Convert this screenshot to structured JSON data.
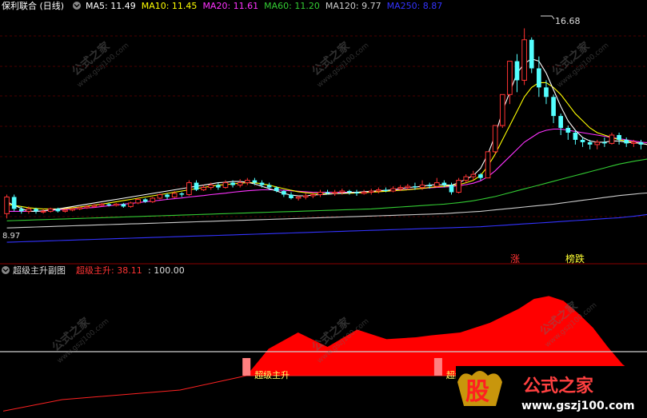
{
  "header": {
    "title": "保利联合 (日线)",
    "ma_labels": [
      {
        "text": "MA5: 11.49",
        "color": "#ffffff"
      },
      {
        "text": "MA10: 11.45",
        "color": "#ffff00"
      },
      {
        "text": "MA20: 11.61",
        "color": "#ff33ff"
      },
      {
        "text": "MA60: 11.20",
        "color": "#33cc33"
      },
      {
        "text": "MA120: 9.77",
        "color": "#cccccc"
      },
      {
        "text": "MA250: 8.87",
        "color": "#3333ff"
      }
    ]
  },
  "sub_header": {
    "title": "超级主升副图",
    "indicator_label": "超级主升: 38.11",
    "indicator_color": "#ff3333",
    "extra": ": 100.00"
  },
  "annotations": {
    "high_price": "16.68",
    "low_price": "8.97",
    "limit_up_tag": "涨",
    "list_tag": "榜跌",
    "signal_label_1": "超级主升",
    "signal_label_2": "超级主升"
  },
  "watermark": {
    "brand_glyph": "股",
    "brand_name": "公式之家",
    "brand_url": "www.gszj100.com",
    "tile_text": "公式之家",
    "tile_url": "www.gszj100.com"
  },
  "chart_data": [
    {
      "type": "candlestick",
      "title": "保利联合 (日线)",
      "colors": {
        "up": "#ff3333",
        "down": "#54ffff",
        "ma5": "#ffffff",
        "ma10": "#ffff00",
        "ma20": "#ff33ff",
        "ma60": "#33cc33",
        "ma120": "#cccccc",
        "ma250": "#3333ff"
      },
      "ylim": [
        7.2,
        17.4
      ],
      "candles": [
        [
          8.9,
          9.6,
          8.7,
          9.7
        ],
        [
          9.6,
          9.1,
          9.0,
          9.7
        ],
        [
          9.1,
          9.0,
          8.9,
          9.2
        ],
        [
          9.0,
          9.1,
          8.9,
          9.2
        ],
        [
          9.1,
          9.0,
          8.9,
          9.15
        ],
        [
          9.0,
          9.0,
          8.9,
          9.1
        ],
        [
          9.0,
          9.1,
          8.95,
          9.15
        ],
        [
          9.1,
          9.0,
          8.95,
          9.15
        ],
        [
          9.0,
          9.05,
          8.95,
          9.1
        ],
        [
          9.05,
          9.1,
          9.0,
          9.15
        ],
        [
          9.1,
          9.15,
          9.05,
          9.2
        ],
        [
          9.15,
          9.2,
          9.1,
          9.25
        ],
        [
          9.2,
          9.25,
          9.15,
          9.3
        ],
        [
          9.25,
          9.3,
          9.2,
          9.35
        ],
        [
          9.3,
          9.25,
          9.2,
          9.35
        ],
        [
          9.25,
          9.3,
          9.2,
          9.35
        ],
        [
          9.3,
          9.2,
          9.15,
          9.35
        ],
        [
          9.2,
          9.35,
          9.15,
          9.4
        ],
        [
          9.35,
          9.5,
          9.3,
          9.55
        ],
        [
          9.5,
          9.4,
          9.35,
          9.55
        ],
        [
          9.4,
          9.55,
          9.35,
          9.6
        ],
        [
          9.55,
          9.7,
          9.5,
          9.75
        ],
        [
          9.7,
          9.6,
          9.5,
          9.75
        ],
        [
          9.6,
          9.75,
          9.55,
          9.85
        ],
        [
          9.75,
          9.7,
          9.6,
          9.8
        ],
        [
          9.7,
          10.2,
          9.65,
          10.3
        ],
        [
          10.2,
          9.9,
          9.85,
          10.3
        ],
        [
          9.9,
          10.0,
          9.85,
          10.1
        ],
        [
          10.0,
          10.1,
          9.9,
          10.2
        ],
        [
          10.1,
          10.0,
          9.9,
          10.2
        ],
        [
          10.0,
          10.2,
          9.95,
          10.3
        ],
        [
          10.2,
          10.1,
          10.0,
          10.3
        ],
        [
          10.1,
          10.2,
          10.0,
          10.35
        ],
        [
          10.2,
          10.3,
          10.1,
          10.4
        ],
        [
          10.3,
          10.2,
          10.1,
          10.4
        ],
        [
          10.2,
          10.1,
          10.0,
          10.3
        ],
        [
          10.1,
          10.0,
          9.9,
          10.2
        ],
        [
          10.0,
          9.85,
          9.8,
          10.05
        ],
        [
          9.85,
          9.7,
          9.6,
          9.9
        ],
        [
          9.7,
          9.55,
          9.5,
          9.8
        ],
        [
          9.55,
          9.6,
          9.45,
          9.65
        ],
        [
          9.6,
          9.65,
          9.5,
          9.75
        ],
        [
          9.65,
          9.7,
          9.55,
          9.8
        ],
        [
          9.7,
          9.8,
          9.6,
          9.9
        ],
        [
          9.8,
          9.75,
          9.7,
          9.9
        ],
        [
          9.75,
          9.8,
          9.65,
          9.9
        ],
        [
          9.8,
          9.85,
          9.7,
          9.95
        ],
        [
          9.85,
          9.8,
          9.7,
          9.9
        ],
        [
          9.8,
          9.75,
          9.65,
          9.9
        ],
        [
          9.75,
          9.8,
          9.7,
          9.9
        ],
        [
          9.8,
          9.85,
          9.7,
          9.95
        ],
        [
          9.85,
          9.9,
          9.75,
          10.0
        ],
        [
          9.9,
          9.85,
          9.8,
          10.0
        ],
        [
          9.85,
          9.95,
          9.8,
          10.05
        ],
        [
          9.95,
          10.0,
          9.85,
          10.1
        ],
        [
          10.0,
          10.05,
          9.9,
          10.15
        ],
        [
          10.05,
          10.0,
          9.9,
          10.2
        ],
        [
          10.0,
          10.1,
          9.9,
          10.3
        ],
        [
          10.1,
          10.05,
          9.95,
          10.2
        ],
        [
          10.05,
          10.2,
          10.0,
          10.4
        ],
        [
          10.2,
          10.1,
          10.0,
          10.3
        ],
        [
          10.1,
          9.8,
          9.7,
          10.2
        ],
        [
          9.8,
          10.3,
          9.75,
          10.4
        ],
        [
          10.3,
          10.45,
          10.2,
          10.55
        ],
        [
          10.45,
          10.55,
          10.3,
          10.7
        ],
        [
          10.55,
          10.4,
          10.3,
          10.6
        ],
        [
          10.4,
          11.5,
          10.4,
          11.5
        ],
        [
          11.5,
          12.6,
          11.4,
          12.6
        ],
        [
          12.6,
          13.9,
          12.5,
          13.9
        ],
        [
          13.9,
          15.3,
          13.5,
          15.3
        ],
        [
          15.3,
          14.5,
          14.0,
          15.6
        ],
        [
          14.5,
          16.2,
          14.3,
          16.68
        ],
        [
          16.2,
          15.0,
          14.8,
          16.3
        ],
        [
          15.0,
          14.2,
          13.8,
          15.5
        ],
        [
          14.2,
          13.8,
          13.5,
          14.5
        ],
        [
          13.8,
          13.0,
          12.7,
          13.9
        ],
        [
          13.0,
          12.5,
          12.2,
          13.1
        ],
        [
          12.5,
          12.3,
          12.0,
          12.6
        ],
        [
          12.3,
          12.0,
          11.8,
          12.4
        ],
        [
          12.0,
          11.9,
          11.7,
          12.1
        ],
        [
          11.9,
          11.8,
          11.6,
          12.0
        ],
        [
          11.8,
          11.9,
          11.6,
          12.0
        ],
        [
          11.9,
          11.85,
          11.7,
          12.1
        ],
        [
          11.85,
          12.2,
          11.8,
          12.3
        ],
        [
          12.2,
          12.0,
          11.8,
          12.3
        ],
        [
          12.0,
          11.85,
          11.7,
          12.1
        ],
        [
          11.85,
          11.9,
          11.7,
          12.0
        ],
        [
          11.9,
          11.8,
          11.6,
          12.0
        ]
      ],
      "ma": {
        "ma5": [
          9.4,
          9.25,
          9.12,
          9.0,
          9.0,
          9.02,
          9.06,
          9.1,
          9.15,
          9.2,
          9.25,
          9.3,
          9.35,
          9.4,
          9.45,
          9.5,
          9.55,
          9.6,
          9.65,
          9.7,
          9.75,
          9.8,
          9.85,
          9.9,
          9.95,
          10.0,
          10.05,
          10.1,
          10.15,
          10.2,
          10.22,
          10.25,
          10.25,
          10.22,
          10.15,
          10.05,
          9.95,
          9.85,
          9.75,
          9.68,
          9.65,
          9.65,
          9.68,
          9.7,
          9.72,
          9.74,
          9.76,
          9.78,
          9.8,
          9.82,
          9.84,
          9.86,
          9.88,
          9.9,
          9.95,
          10.0,
          10.02,
          10.05,
          10.1,
          10.12,
          10.1,
          10.1,
          10.2,
          10.35,
          10.5,
          10.8,
          11.4,
          12.2,
          13.2,
          14.0,
          14.8,
          15.2,
          15.4,
          15.3,
          14.8,
          14.1,
          13.4,
          12.8,
          12.4,
          12.1,
          11.95,
          11.9,
          11.9,
          11.95,
          11.95,
          11.9,
          11.88,
          11.85,
          11.8
        ],
        "ma10": [
          9.3,
          9.25,
          9.2,
          9.15,
          9.12,
          9.1,
          9.1,
          9.1,
          9.12,
          9.15,
          9.18,
          9.22,
          9.26,
          9.3,
          9.35,
          9.4,
          9.45,
          9.5,
          9.55,
          9.6,
          9.65,
          9.7,
          9.75,
          9.8,
          9.85,
          9.9,
          9.95,
          10.0,
          10.05,
          10.1,
          10.12,
          10.15,
          10.18,
          10.2,
          10.2,
          10.15,
          10.1,
          10.02,
          9.95,
          9.88,
          9.82,
          9.78,
          9.75,
          9.74,
          9.74,
          9.74,
          9.75,
          9.76,
          9.77,
          9.78,
          9.8,
          9.82,
          9.84,
          9.86,
          9.88,
          9.9,
          9.93,
          9.96,
          10.0,
          10.03,
          10.05,
          10.08,
          10.12,
          10.2,
          10.3,
          10.5,
          10.9,
          11.4,
          12.0,
          12.6,
          13.2,
          13.8,
          14.2,
          14.4,
          14.4,
          14.2,
          13.9,
          13.5,
          13.1,
          12.8,
          12.5,
          12.3,
          12.2,
          12.1,
          12.0,
          11.95,
          11.9,
          11.85,
          11.8
        ],
        "ma20": [
          9.0,
          9.0,
          9.0,
          9.0,
          9.0,
          9.02,
          9.04,
          9.06,
          9.08,
          9.1,
          9.12,
          9.14,
          9.16,
          9.2,
          9.23,
          9.26,
          9.3,
          9.33,
          9.36,
          9.4,
          9.43,
          9.46,
          9.5,
          9.53,
          9.56,
          9.6,
          9.63,
          9.66,
          9.7,
          9.73,
          9.76,
          9.8,
          9.83,
          9.86,
          9.88,
          9.9,
          9.9,
          9.9,
          9.88,
          9.86,
          9.84,
          9.82,
          9.8,
          9.8,
          9.8,
          9.8,
          9.8,
          9.8,
          9.8,
          9.8,
          9.82,
          9.84,
          9.86,
          9.88,
          9.9,
          9.92,
          9.94,
          9.96,
          9.98,
          10.0,
          10.02,
          10.04,
          10.08,
          10.12,
          10.18,
          10.28,
          10.45,
          10.7,
          11.0,
          11.3,
          11.6,
          11.9,
          12.1,
          12.3,
          12.4,
          12.45,
          12.45,
          12.4,
          12.35,
          12.3,
          12.25,
          12.2,
          12.15,
          12.1,
          12.05,
          12.0,
          11.95,
          11.9,
          11.88
        ],
        "ma60": [
          8.6,
          8.61,
          8.62,
          8.63,
          8.64,
          8.65,
          8.66,
          8.67,
          8.68,
          8.69,
          8.7,
          8.71,
          8.72,
          8.73,
          8.74,
          8.75,
          8.76,
          8.77,
          8.78,
          8.79,
          8.8,
          8.81,
          8.82,
          8.83,
          8.84,
          8.85,
          8.86,
          8.87,
          8.88,
          8.89,
          8.9,
          8.91,
          8.92,
          8.93,
          8.94,
          8.95,
          8.96,
          8.97,
          8.98,
          8.99,
          9.0,
          9.01,
          9.02,
          9.03,
          9.04,
          9.05,
          9.06,
          9.07,
          9.08,
          9.09,
          9.1,
          9.12,
          9.14,
          9.16,
          9.18,
          9.2,
          9.22,
          9.24,
          9.26,
          9.28,
          9.3,
          9.33,
          9.36,
          9.4,
          9.44,
          9.5,
          9.56,
          9.62,
          9.7,
          9.78,
          9.86,
          9.94,
          10.02,
          10.1,
          10.18,
          10.26,
          10.34,
          10.42,
          10.5,
          10.58,
          10.66,
          10.74,
          10.82,
          10.9,
          10.98,
          11.04,
          11.1,
          11.15,
          11.2
        ],
        "ma120": [
          8.3,
          8.31,
          8.32,
          8.33,
          8.34,
          8.35,
          8.36,
          8.37,
          8.38,
          8.39,
          8.4,
          8.41,
          8.42,
          8.43,
          8.44,
          8.45,
          8.46,
          8.47,
          8.48,
          8.49,
          8.5,
          8.51,
          8.52,
          8.53,
          8.54,
          8.55,
          8.56,
          8.57,
          8.58,
          8.59,
          8.6,
          8.61,
          8.62,
          8.63,
          8.64,
          8.65,
          8.66,
          8.67,
          8.68,
          8.69,
          8.7,
          8.71,
          8.72,
          8.73,
          8.74,
          8.75,
          8.76,
          8.77,
          8.78,
          8.79,
          8.8,
          8.81,
          8.82,
          8.83,
          8.84,
          8.85,
          8.86,
          8.87,
          8.88,
          8.89,
          8.9,
          8.92,
          8.94,
          8.96,
          8.98,
          9.0,
          9.03,
          9.06,
          9.09,
          9.12,
          9.15,
          9.18,
          9.21,
          9.24,
          9.27,
          9.3,
          9.34,
          9.38,
          9.42,
          9.46,
          9.5,
          9.54,
          9.58,
          9.62,
          9.66,
          9.69,
          9.72,
          9.75,
          9.77
        ],
        "ma250": [
          7.7,
          7.71,
          7.72,
          7.73,
          7.74,
          7.75,
          7.76,
          7.77,
          7.78,
          7.79,
          7.8,
          7.81,
          7.82,
          7.83,
          7.84,
          7.85,
          7.86,
          7.87,
          7.88,
          7.89,
          7.9,
          7.91,
          7.92,
          7.93,
          7.94,
          7.95,
          7.96,
          7.97,
          7.98,
          7.99,
          8.0,
          8.01,
          8.02,
          8.03,
          8.04,
          8.05,
          8.06,
          8.07,
          8.08,
          8.09,
          8.1,
          8.11,
          8.12,
          8.13,
          8.14,
          8.15,
          8.16,
          8.17,
          8.18,
          8.19,
          8.2,
          8.21,
          8.22,
          8.23,
          8.24,
          8.25,
          8.26,
          8.27,
          8.28,
          8.29,
          8.3,
          8.31,
          8.32,
          8.33,
          8.34,
          8.35,
          8.37,
          8.39,
          8.41,
          8.43,
          8.45,
          8.47,
          8.49,
          8.51,
          8.53,
          8.55,
          8.57,
          8.59,
          8.61,
          8.63,
          8.65,
          8.67,
          8.69,
          8.71,
          8.73,
          8.76,
          8.79,
          8.83,
          8.87
        ]
      }
    },
    {
      "type": "area",
      "title": "超级主升副图",
      "series": [
        {
          "name": "超级主升",
          "color": "#ff0000"
        }
      ],
      "ylim": [
        -40,
        100
      ],
      "threshold": 0,
      "x": [
        0,
        8,
        16,
        24,
        30,
        33,
        36,
        40,
        44,
        48,
        52,
        56,
        58,
        62,
        66,
        70,
        72,
        74,
        76,
        78,
        80,
        82,
        84,
        86,
        88
      ],
      "values": [
        -37,
        -25,
        -20,
        -15,
        -5,
        0,
        28,
        45,
        30,
        48,
        38,
        40,
        42,
        45,
        55,
        70,
        80,
        83,
        78,
        65,
        50,
        30,
        12,
        -5,
        -20
      ],
      "signals": [
        33,
        59
      ]
    }
  ]
}
